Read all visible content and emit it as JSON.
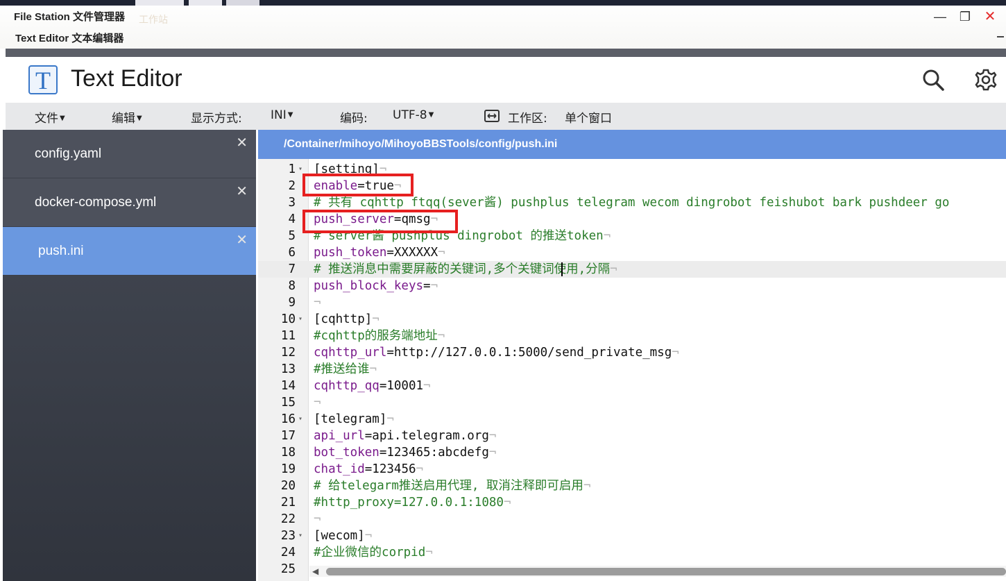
{
  "window": {
    "title_outer": "File Station 文件管理器",
    "title_inner": "Text Editor 文本编辑器",
    "ghost_text": "工作站",
    "minimize_glyph": "—",
    "maximize_glyph": "❐",
    "close_glyph": "✕"
  },
  "app": {
    "title": "Text Editor",
    "logo_letter": "T"
  },
  "icons": {
    "search": "search-icon",
    "settings": "gear-icon",
    "workspace": "workspace-icon"
  },
  "menubar": {
    "file": "文件",
    "edit": "编辑",
    "display_label": "显示方式:",
    "display_value": "INI",
    "encoding_label": "编码:",
    "encoding_value": "UTF-8",
    "workspace_label": "工作区:",
    "workspace_value": "单个窗口"
  },
  "tabs": [
    {
      "label": "config.yaml",
      "close": "✕",
      "active": false
    },
    {
      "label": "docker-compose.yml",
      "close": "✕",
      "active": false
    },
    {
      "label": "push.ini",
      "close": "✕",
      "active": true
    }
  ],
  "editor": {
    "path": "/Container/mihoyo/MihoyoBBSTools/config/push.ini",
    "fold_marker": "▾",
    "eol_marker": "¬",
    "lines": [
      {
        "n": "1",
        "t": "section",
        "a": "[setting]",
        "fold": true
      },
      {
        "n": "2",
        "t": "kv",
        "a": "enable",
        "b": "=true"
      },
      {
        "n": "3",
        "t": "comment",
        "a": "# 共有 cqhttp ftqq(sever酱) pushplus telegram wecom dingrobot feishubot bark pushdeer go"
      },
      {
        "n": "4",
        "t": "kv",
        "a": "push_server",
        "b": "=qmsg"
      },
      {
        "n": "5",
        "t": "comment",
        "a": "# server酱 pushplus dingrobot 的推送token"
      },
      {
        "n": "6",
        "t": "kv",
        "a": "push_token",
        "b": "=XXXXXX"
      },
      {
        "n": "7",
        "t": "comment",
        "a": "# 推送消息中需要屏蔽的关键词,多个关键词使用,分隔",
        "current": true
      },
      {
        "n": "8",
        "t": "kv",
        "a": "push_block_keys",
        "b": "="
      },
      {
        "n": "9",
        "t": "empty",
        "a": ""
      },
      {
        "n": "10",
        "t": "section",
        "a": "[cqhttp]",
        "fold": true
      },
      {
        "n": "11",
        "t": "comment",
        "a": "#cqhttp的服务端地址"
      },
      {
        "n": "12",
        "t": "kv",
        "a": "cqhttp_url",
        "b": "=http://127.0.0.1:5000/send_private_msg"
      },
      {
        "n": "13",
        "t": "comment",
        "a": "#推送给谁"
      },
      {
        "n": "14",
        "t": "kv",
        "a": "cqhttp_qq",
        "b": "=10001"
      },
      {
        "n": "15",
        "t": "empty",
        "a": ""
      },
      {
        "n": "16",
        "t": "section",
        "a": "[telegram]",
        "fold": true
      },
      {
        "n": "17",
        "t": "kv",
        "a": "api_url",
        "b": "=api.telegram.org"
      },
      {
        "n": "18",
        "t": "kv",
        "a": "bot_token",
        "b": "=123465:abcdefg"
      },
      {
        "n": "19",
        "t": "kv",
        "a": "chat_id",
        "b": "=123456"
      },
      {
        "n": "20",
        "t": "comment",
        "a": "# 给telegarm推送启用代理, 取消注释即可启用"
      },
      {
        "n": "21",
        "t": "comment",
        "a": "#http_proxy=127.0.0.1:1080"
      },
      {
        "n": "22",
        "t": "empty",
        "a": ""
      },
      {
        "n": "23",
        "t": "section",
        "a": "[wecom]",
        "fold": true
      },
      {
        "n": "24",
        "t": "comment",
        "a": "#企业微信的corpid"
      },
      {
        "n": "25",
        "t": "empty",
        "a": ""
      }
    ]
  },
  "colors": {
    "accent": "#6592df",
    "highlight": "#e62020",
    "key": "#7a1b8c",
    "comment": "#2a7d2a",
    "sidebar": "#4d515c"
  }
}
